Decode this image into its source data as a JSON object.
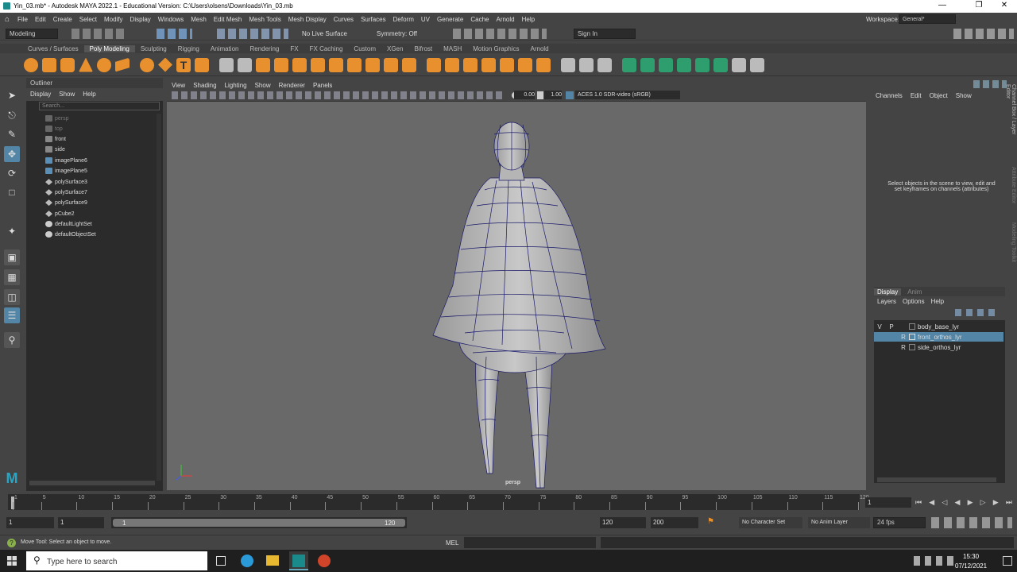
{
  "window": {
    "title": "Yin_03.mb* - Autodesk MAYA 2022.1 - Educational Version: C:\\Users\\olsens\\Downloads\\Yin_03.mb",
    "minimize": "—",
    "restore": "❐",
    "close": "✕"
  },
  "menubar": {
    "items": [
      "File",
      "Edit",
      "Create",
      "Select",
      "Modify",
      "Display",
      "Windows",
      "Mesh",
      "Edit Mesh",
      "Mesh Tools",
      "Mesh Display",
      "Curves",
      "Surfaces",
      "Deform",
      "UV",
      "Generate",
      "Cache",
      "Arnold",
      "Help"
    ],
    "workspace_label": "Workspace:",
    "workspace_value": "General*"
  },
  "statusline": {
    "mode": "Modeling",
    "live_surface": "No Live Surface",
    "symmetry": "Symmetry: Off",
    "sign_in": "Sign In"
  },
  "shelf": {
    "tabs": [
      "Curves / Surfaces",
      "Poly Modeling",
      "Sculpting",
      "Rigging",
      "Animation",
      "Rendering",
      "FX",
      "FX Caching",
      "Custom",
      "XGen",
      "Bifrost",
      "MASH",
      "Motion Graphics",
      "Arnold"
    ],
    "active_tab": "Poly Modeling"
  },
  "outliner": {
    "title": "Outliner",
    "menu": [
      "Display",
      "Show",
      "Help"
    ],
    "search_placeholder": "Search...",
    "items": [
      "persp",
      "top",
      "front",
      "side",
      "imagePlane6",
      "imagePlane5",
      "polySurface3",
      "polySurface7",
      "polySurface9",
      "pCube2",
      "defaultLightSet",
      "defaultObjectSet"
    ]
  },
  "viewport": {
    "menu": [
      "View",
      "Shading",
      "Lighting",
      "Show",
      "Renderer",
      "Panels"
    ],
    "exposure": "0.00",
    "gamma": "1.00",
    "colorspace": "ACES 1.0 SDR-video (sRGB)",
    "camera_label": "persp"
  },
  "channelbox": {
    "menu": [
      "Channels",
      "Edit",
      "Object",
      "Show"
    ],
    "message": "Select objects in the scene to view, edit and set keyframes on channels (attributes)",
    "side_tabs": [
      "Channel Box / Layer Editor",
      "Attribute Editor",
      "Modeling Toolkit"
    ]
  },
  "layers": {
    "tabs": [
      "Display",
      "Anim"
    ],
    "menu": [
      "Layers",
      "Options",
      "Help"
    ],
    "rows": [
      {
        "v": "V",
        "p": "P",
        "r": "",
        "name": "body_base_lyr"
      },
      {
        "v": "",
        "p": "",
        "r": "R",
        "name": "front_orthos_lyr"
      },
      {
        "v": "",
        "p": "",
        "r": "R",
        "name": "side_orthos_lyr"
      }
    ]
  },
  "timeline": {
    "ticks": [
      "1",
      "5",
      "10",
      "15",
      "20",
      "25",
      "30",
      "35",
      "40",
      "45",
      "50",
      "55",
      "60",
      "65",
      "70",
      "75",
      "80",
      "85",
      "90",
      "95",
      "100",
      "105",
      "110",
      "115",
      "120"
    ],
    "current_frame": "1"
  },
  "range": {
    "start": "1",
    "playback_start": "1",
    "slider_start": "1",
    "slider_end": "120",
    "playback_end": "120",
    "end": "200",
    "character_set": "No Character Set",
    "anim_layer": "No Anim Layer",
    "fps": "24 fps"
  },
  "helpline": {
    "text": "Move Tool: Select an object to move.",
    "mel_label": "MEL"
  },
  "taskbar": {
    "search_placeholder": "Type here to search",
    "time": "15:30",
    "date": "07/12/2021"
  }
}
